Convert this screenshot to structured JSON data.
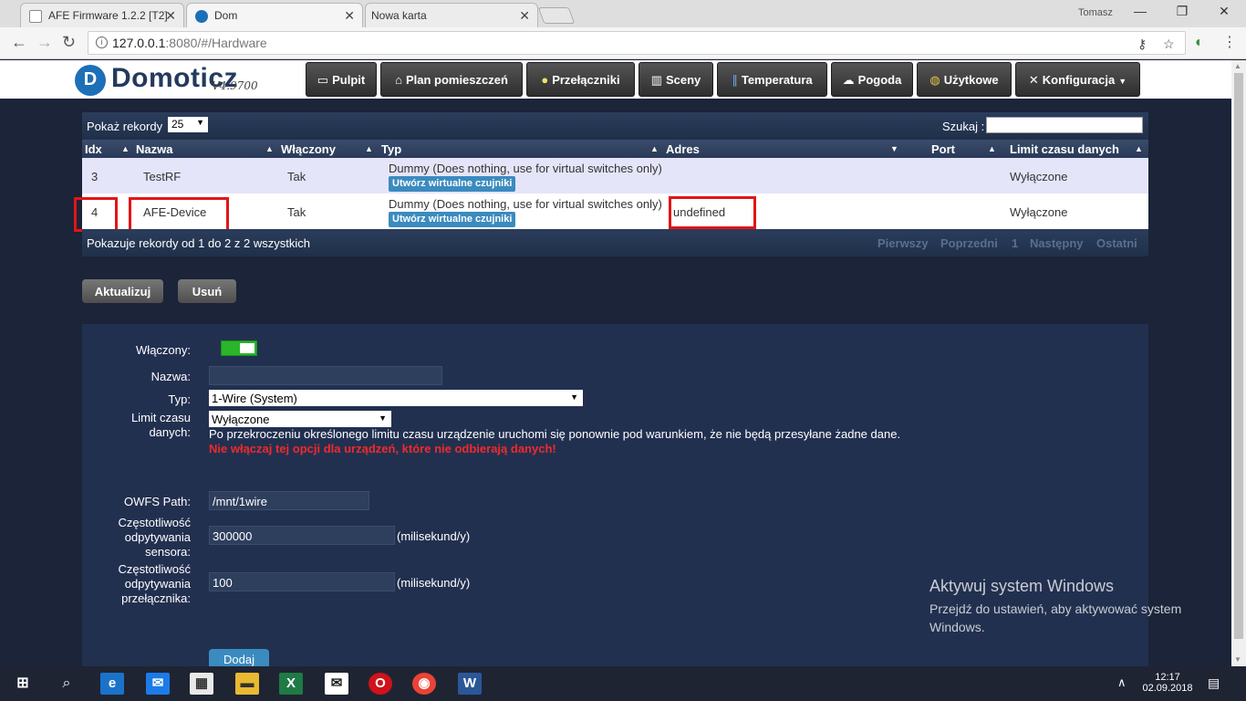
{
  "browser": {
    "tabs": [
      {
        "title": "AFE Firmware 1.2.2 [T2]",
        "icon_color": "#8a8a8a"
      },
      {
        "title": "Dom",
        "icon_color": "#1d6fb8"
      },
      {
        "title": "Nowa karta",
        "icon_color": ""
      }
    ],
    "user": "Tomasz",
    "url_host": "127.0.0.1",
    "url_path": ":8080/#/Hardware"
  },
  "app": {
    "logo_letter": "D",
    "logo_word": "Domoticz",
    "version": "V4.9700",
    "menu": [
      "Pulpit",
      "Plan pomieszczeń",
      "Przełączniki",
      "Sceny",
      "Temperatura",
      "Pogoda",
      "Użytkowe",
      "Konfiguracja"
    ],
    "menu_icons": [
      "▭",
      "⌂",
      "●",
      "▥",
      "∥",
      "☁",
      "◍",
      "✕"
    ]
  },
  "table": {
    "show_label": "Pokaż rekordy",
    "show_value": "25",
    "search_label": "Szukaj :",
    "headers": [
      "Idx",
      "Nazwa",
      "Włączony",
      "Typ",
      "Adres",
      "Port",
      "Limit czasu danych"
    ],
    "rows": [
      {
        "idx": "3",
        "name": "TestRF",
        "enabled": "Tak",
        "type": "Dummy (Does nothing, use for virtual switches only)",
        "type_btn": "Utwórz wirtualne czujniki",
        "address": "",
        "port": "",
        "timeout": "Wyłączone"
      },
      {
        "idx": "4",
        "name": "AFE-Device",
        "enabled": "Tak",
        "type": "Dummy (Does nothing, use for virtual switches only)",
        "type_btn": "Utwórz wirtualne czujniki",
        "address": "undefined",
        "port": "",
        "timeout": "Wyłączone"
      }
    ],
    "footer_info": "Pokazuje rekordy od 1 do 2 z 2 wszystkich",
    "pager": [
      "Pierwszy",
      "Poprzedni",
      "1",
      "Następny",
      "Ostatni"
    ]
  },
  "actions": {
    "update": "Aktualizuj",
    "delete": "Usuń"
  },
  "form": {
    "enabled_label": "Włączony:",
    "name_label": "Nazwa:",
    "name_value": "",
    "type_label": "Typ:",
    "type_value": "1-Wire (System)",
    "timeout_label_1": "Limit czasu",
    "timeout_label_2": "danych:",
    "timeout_value": "Wyłączone",
    "timeout_info": "Po przekroczeniu określonego limitu czasu urządzenie uruchomi się ponownie pod warunkiem, że nie będą przesyłane żadne dane.",
    "timeout_warning": "Nie włączaj tej opcji dla urządzeń, które nie odbierają danych!",
    "owfs_label": "OWFS Path:",
    "owfs_value": "/mnt/1wire",
    "sensor_label_1": "Częstotliwość",
    "sensor_label_2": "odpytywania",
    "sensor_label_3": "sensora:",
    "sensor_value": "300000",
    "sensor_unit": "(milisekund/y)",
    "switch_label_1": "Częstotliwość",
    "switch_label_2": "odpytywania",
    "switch_label_3": "przełącznika:",
    "switch_value": "100",
    "switch_unit": "(milisekund/y)",
    "add_btn": "Dodaj"
  },
  "watermark": {
    "line1": "Aktywuj system Windows",
    "line2": "Przejdź do ustawień, aby aktywować system",
    "line3": "Windows."
  },
  "taskbar": {
    "time": "12:17",
    "date": "02.09.2018"
  }
}
